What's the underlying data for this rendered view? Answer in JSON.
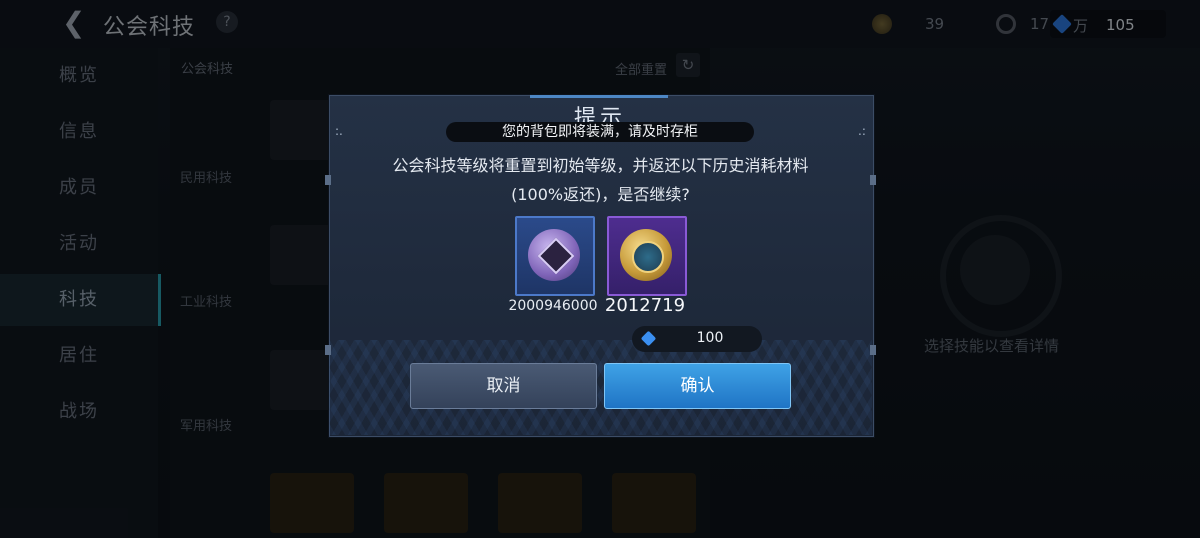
{
  "header": {
    "title": "公会科技",
    "help_icon_label": "?",
    "back_icon": "chevron-left-icon"
  },
  "resources": {
    "coin_value": "39",
    "res2_value": "17",
    "res2_unit": "万",
    "gem_value": "105"
  },
  "sidebar": {
    "items": [
      {
        "label": "概览",
        "active": false
      },
      {
        "label": "信息",
        "active": false
      },
      {
        "label": "成员",
        "active": false
      },
      {
        "label": "活动",
        "active": false
      },
      {
        "label": "科技",
        "active": true
      },
      {
        "label": "居住",
        "active": false
      },
      {
        "label": "战场",
        "active": false
      }
    ]
  },
  "main": {
    "section_title": "公会科技",
    "reset_all_label": "全部重置",
    "categories": [
      "民用科技",
      "工业科技",
      "军用科技"
    ],
    "detail_hint": "选择技能以查看详情"
  },
  "dialog": {
    "title": "提示",
    "toast": "您的背包即将装满，请及时存柜",
    "message_line1": "公会科技等级将重置到初始等级，并返还以下历史消耗材料",
    "message_line2": "(100%返还)，是否继续?",
    "items": [
      {
        "icon": "purple-crystal-coin-icon",
        "count": "2000946000"
      },
      {
        "icon": "gold-emblem-coin-icon",
        "count": "2012719"
      }
    ],
    "cost": {
      "icon": "blue-gem-icon",
      "value": "100"
    },
    "cancel_label": "取消",
    "confirm_label": "确认"
  },
  "colors": {
    "accent_blue": "#2f8de0",
    "item_blue_frame": "#4c79c9",
    "item_purple_frame": "#8a5ad6",
    "nav_active_bar": "#2aa3b3"
  }
}
